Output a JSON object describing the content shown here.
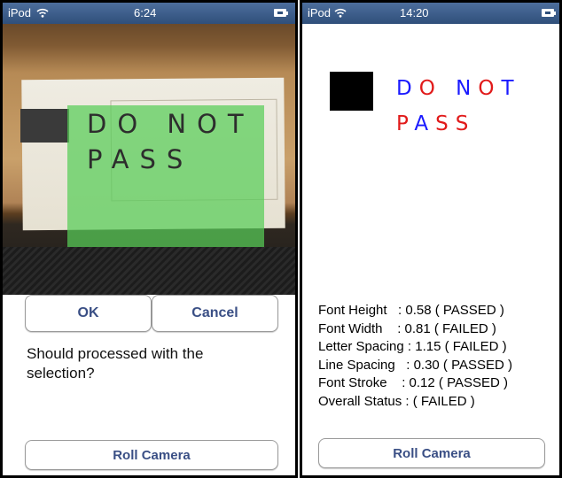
{
  "left_screen": {
    "status": {
      "carrier": "iPod",
      "time": "6:24"
    },
    "photo": {
      "text_line1": "DO NOT",
      "text_line2": "PASS"
    },
    "buttons": {
      "ok": "OK",
      "cancel": "Cancel",
      "roll_camera": "Roll Camera"
    },
    "question": "Should processed with the selection?"
  },
  "right_screen": {
    "status": {
      "carrier": "iPod",
      "time": "14:20"
    },
    "sign": {
      "line1": [
        {
          "char": "D",
          "color": "#1a1aff"
        },
        {
          "char": "O",
          "color": "#e11a1a"
        },
        {
          "char": " ",
          "color": "#1a1aff"
        },
        {
          "char": "N",
          "color": "#1a1aff"
        },
        {
          "char": "O",
          "color": "#e11a1a"
        },
        {
          "char": "T",
          "color": "#1a1aff"
        }
      ],
      "line2": [
        {
          "char": "P",
          "color": "#e11a1a"
        },
        {
          "char": "A",
          "color": "#1a1aff"
        },
        {
          "char": "S",
          "color": "#e11a1a"
        },
        {
          "char": "S",
          "color": "#e11a1a"
        }
      ]
    },
    "results": [
      "Font Height   : 0.58 ( PASSED )",
      "Font Width    : 0.81 ( FAILED )",
      "Letter Spacing : 1.15 ( FAILED )",
      "Line Spacing   : 0.30 ( PASSED )",
      "Font Stroke    : 0.12 ( PASSED )",
      "Overall Status : ( FAILED )"
    ],
    "buttons": {
      "roll_camera": "Roll Camera"
    }
  },
  "colors": {
    "statusbar": "#3d5d8a",
    "button_text": "#3a4f85",
    "overlay_green": "#58cd58"
  }
}
